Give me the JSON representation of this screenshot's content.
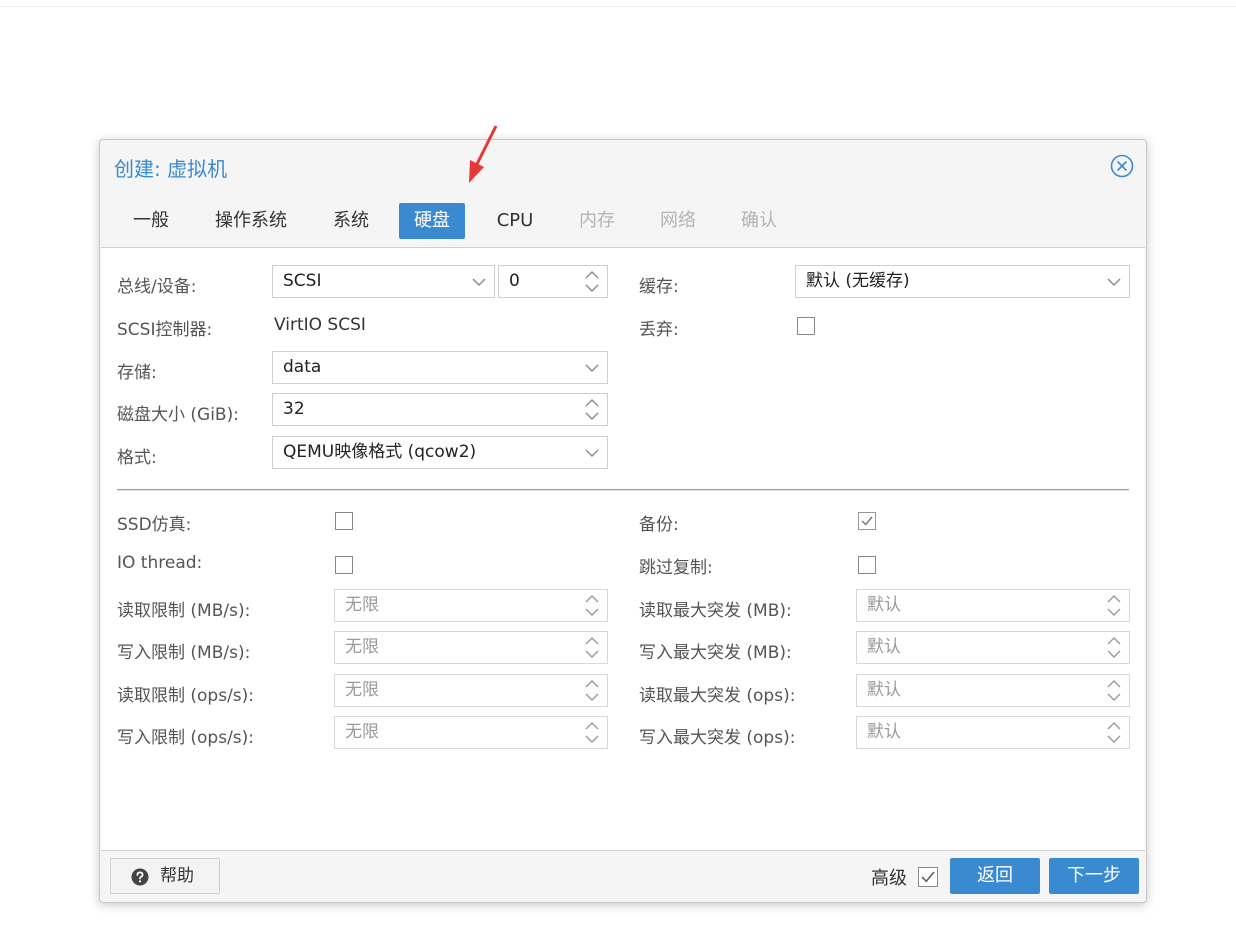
{
  "dialog": {
    "title": "创建: 虚拟机",
    "tabs": [
      {
        "label": "一般",
        "state": "normal"
      },
      {
        "label": "操作系统",
        "state": "normal"
      },
      {
        "label": "系统",
        "state": "normal"
      },
      {
        "label": "硬盘",
        "state": "active"
      },
      {
        "label": "CPU",
        "state": "normal"
      },
      {
        "label": "内存",
        "state": "disabled"
      },
      {
        "label": "网络",
        "state": "disabled"
      },
      {
        "label": "确认",
        "state": "disabled"
      }
    ]
  },
  "disk": {
    "bus_label": "总线/设备:",
    "bus_value": "SCSI",
    "device_value": "0",
    "controller_label": "SCSI控制器:",
    "controller_value": "VirtIO SCSI",
    "storage_label": "存储:",
    "storage_value": "data",
    "size_label": "磁盘大小 (GiB):",
    "size_value": "32",
    "format_label": "格式:",
    "format_value": "QEMU映像格式 (qcow2)",
    "cache_label": "缓存:",
    "cache_value": "默认 (无缓存)",
    "discard_label": "丢弃:",
    "discard_checked": false
  },
  "advanced": {
    "ssd_label": "SSD仿真:",
    "ssd_checked": false,
    "iothread_label": "IO thread:",
    "iothread_checked": false,
    "backup_label": "备份:",
    "backup_checked": true,
    "skip_replication_label": "跳过复制:",
    "skip_replication_checked": false,
    "limits": [
      {
        "label": "读取限制 (MB/s):",
        "value": "无限"
      },
      {
        "label": "写入限制 (MB/s):",
        "value": "无限"
      },
      {
        "label": "读取限制 (ops/s):",
        "value": "无限"
      },
      {
        "label": "写入限制 (ops/s):",
        "value": "无限"
      }
    ],
    "bursts": [
      {
        "label": "读取最大突发 (MB):",
        "value": "默认"
      },
      {
        "label": "写入最大突发 (MB):",
        "value": "默认"
      },
      {
        "label": "读取最大突发 (ops):",
        "value": "默认"
      },
      {
        "label": "写入最大突发 (ops):",
        "value": "默认"
      }
    ]
  },
  "footer": {
    "help_label": "帮助",
    "advanced_label": "高级",
    "advanced_checked": true,
    "back_label": "返回",
    "next_label": "下一步"
  },
  "colors": {
    "accent": "#3a8ad1",
    "annotation_arrow": "#e53935"
  }
}
